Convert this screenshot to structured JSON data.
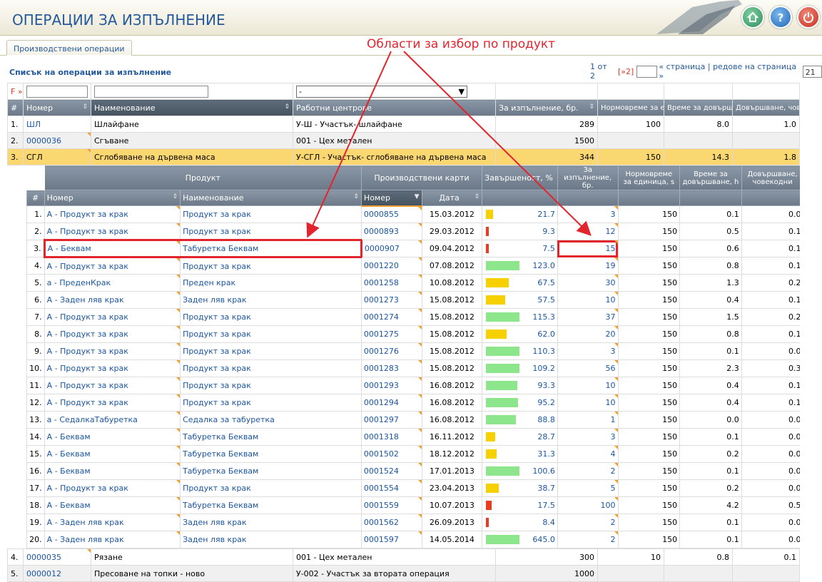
{
  "header": {
    "title": "ОПЕРАЦИИ ЗА ИЗПЪЛНЕНИЕ",
    "icons": [
      "home-icon",
      "help-icon",
      "power-icon"
    ]
  },
  "tabs": [
    {
      "label": "Производствени операции",
      "active": true
    }
  ],
  "annotation": {
    "text": "Области за избор по продукт",
    "color": "#e4242c"
  },
  "list": {
    "title": "Списък на операции за изпълнение",
    "pager": {
      "position": "1 от 2",
      "next": "[»2]",
      "page_label": "« страница | редове на страница »",
      "rows_per_page": "21"
    }
  },
  "filters": {
    "mark": "F »",
    "select_value": "-"
  },
  "main_columns": [
    "#",
    "Номер",
    "Наименование",
    "Работни центрове",
    "За изпълнение, бр.",
    "Нормовреме за единица, s",
    "Време за довършване, h",
    "Довършване, човекодни"
  ],
  "main_rows_top": [
    {
      "idx": "1.",
      "num": "ШЛ",
      "name": "Шлайфане",
      "wc": "У-Ш - Участък- шлайфане",
      "qty": "289",
      "norm": "100",
      "time": "8.0",
      "days": "1.0"
    },
    {
      "idx": "2.",
      "num": "0000036",
      "name": "Сгъване",
      "wc": "001 - Цех метален",
      "qty": "1500",
      "norm": "",
      "time": "",
      "days": ""
    },
    {
      "idx": "3.",
      "num": "СГЛ",
      "name": "Сглобяване на дървена маса",
      "wc": "У-СГЛ - Участък- сглобяване на дървена маса",
      "qty": "344",
      "norm": "150",
      "time": "14.3",
      "days": "1.8"
    }
  ],
  "sub_group_headers": {
    "product": "Продукт",
    "cards": "Производствени карти"
  },
  "sub_columns": [
    "#",
    "Номер",
    "Наименование",
    "Номер",
    "Дата",
    "Завършеност, %",
    "За изпълнение, бр.",
    "Нормовреме за единица, s",
    "Време за довършване, h",
    "Довършване, човекодни"
  ],
  "sub_rows": [
    {
      "idx": "1.",
      "pnum": "А - Продукт за крак",
      "pname": "Продукт за крак",
      "card": "0000855",
      "date": "15.03.2012",
      "pct": "21.7",
      "qty": "3",
      "norm": "150",
      "time": "0.1",
      "days": "0.0"
    },
    {
      "idx": "2.",
      "pnum": "А - Продукт за крак",
      "pname": "Продукт за крак",
      "card": "0000893",
      "date": "29.03.2012",
      "pct": "9.3",
      "qty": "12",
      "norm": "150",
      "time": "0.5",
      "days": "0.1"
    },
    {
      "idx": "3.",
      "pnum": "А - Беквам",
      "pname": "Табуретка Беквам",
      "card": "0000907",
      "date": "09.04.2012",
      "pct": "7.5",
      "qty": "15",
      "norm": "150",
      "time": "0.6",
      "days": "0.1"
    },
    {
      "idx": "4.",
      "pnum": "А - Продукт за крак",
      "pname": "Продукт за крак",
      "card": "0001220",
      "date": "07.08.2012",
      "pct": "123.0",
      "qty": "19",
      "norm": "150",
      "time": "0.8",
      "days": "0.1"
    },
    {
      "idx": "5.",
      "pnum": "а - ПреденКрак",
      "pname": "Преден крак",
      "card": "0001258",
      "date": "10.08.2012",
      "pct": "67.5",
      "qty": "30",
      "norm": "150",
      "time": "1.3",
      "days": "0.2"
    },
    {
      "idx": "6.",
      "pnum": "А - Заден ляв крак",
      "pname": "Заден ляв крак",
      "card": "0001273",
      "date": "15.08.2012",
      "pct": "57.5",
      "qty": "10",
      "norm": "150",
      "time": "0.4",
      "days": "0.1"
    },
    {
      "idx": "7.",
      "pnum": "А - Продукт за крак",
      "pname": "Продукт за крак",
      "card": "0001274",
      "date": "15.08.2012",
      "pct": "115.3",
      "qty": "37",
      "norm": "150",
      "time": "1.5",
      "days": "0.2"
    },
    {
      "idx": "8.",
      "pnum": "А - Продукт за крак",
      "pname": "Продукт за крак",
      "card": "0001275",
      "date": "15.08.2012",
      "pct": "62.0",
      "qty": "20",
      "norm": "150",
      "time": "0.8",
      "days": "0.1"
    },
    {
      "idx": "9.",
      "pnum": "А - Продукт за крак",
      "pname": "Продукт за крак",
      "card": "0001276",
      "date": "15.08.2012",
      "pct": "110.3",
      "qty": "3",
      "norm": "150",
      "time": "0.1",
      "days": "0.0"
    },
    {
      "idx": "10.",
      "pnum": "А - Продукт за крак",
      "pname": "Продукт за крак",
      "card": "0001283",
      "date": "15.08.2012",
      "pct": "109.2",
      "qty": "56",
      "norm": "150",
      "time": "2.3",
      "days": "0.3"
    },
    {
      "idx": "11.",
      "pnum": "А - Продукт за крак",
      "pname": "Продукт за крак",
      "card": "0001293",
      "date": "16.08.2012",
      "pct": "93.3",
      "qty": "10",
      "norm": "150",
      "time": "0.4",
      "days": "0.1"
    },
    {
      "idx": "12.",
      "pnum": "А - Продукт за крак",
      "pname": "Продукт за крак",
      "card": "0001294",
      "date": "16.08.2012",
      "pct": "95.2",
      "qty": "10",
      "norm": "150",
      "time": "0.4",
      "days": "0.1"
    },
    {
      "idx": "13.",
      "pnum": "а - СедалкаТабуретка",
      "pname": "Седалка за табуретка",
      "card": "0001297",
      "date": "16.08.2012",
      "pct": "88.8",
      "qty": "1",
      "norm": "150",
      "time": "0.0",
      "days": "0.0"
    },
    {
      "idx": "14.",
      "pnum": "А - Беквам",
      "pname": "Табуретка Беквам",
      "card": "0001318",
      "date": "16.11.2012",
      "pct": "28.7",
      "qty": "3",
      "norm": "150",
      "time": "0.1",
      "days": "0.0"
    },
    {
      "idx": "15.",
      "pnum": "А - Беквам",
      "pname": "Табуретка Беквам",
      "card": "0001502",
      "date": "18.12.2012",
      "pct": "31.3",
      "qty": "4",
      "norm": "150",
      "time": "0.2",
      "days": "0.0"
    },
    {
      "idx": "16.",
      "pnum": "А - Беквам",
      "pname": "Табуретка Беквам",
      "card": "0001524",
      "date": "17.01.2013",
      "pct": "100.6",
      "qty": "2",
      "norm": "150",
      "time": "0.1",
      "days": "0.0"
    },
    {
      "idx": "17.",
      "pnum": "А - Продукт за крак",
      "pname": "Продукт за крак",
      "card": "0001554",
      "date": "23.04.2013",
      "pct": "38.7",
      "qty": "5",
      "norm": "150",
      "time": "0.2",
      "days": "0.0"
    },
    {
      "idx": "18.",
      "pnum": "А - Беквам",
      "pname": "Табуретка Беквам",
      "card": "0001559",
      "date": "10.07.2013",
      "pct": "17.5",
      "qty": "100",
      "norm": "150",
      "time": "4.2",
      "days": "0.5"
    },
    {
      "idx": "19.",
      "pnum": "А - Заден ляв крак",
      "pname": "Заден ляв крак",
      "card": "0001562",
      "date": "26.09.2013",
      "pct": "8.4",
      "qty": "2",
      "norm": "150",
      "time": "0.1",
      "days": "0.0"
    },
    {
      "idx": "20.",
      "pnum": "А - Заден ляв крак",
      "pname": "Заден ляв крак",
      "card": "0001597",
      "date": "14.05.2014",
      "pct": "645.0",
      "qty": "2",
      "norm": "150",
      "time": "0.1",
      "days": "0.0"
    }
  ],
  "main_rows_bottom": [
    {
      "idx": "4.",
      "num": "0000035",
      "name": "Рязане",
      "wc": "001 - Цех метален",
      "qty": "300",
      "norm": "10",
      "time": "0.8",
      "days": "0.1"
    },
    {
      "idx": "5.",
      "num": "0000012",
      "name": "Пресоване на топки - ново",
      "wc": "У-002 - Участък за втората операция",
      "qty": "1000",
      "norm": "",
      "time": "",
      "days": ""
    }
  ],
  "bar_colors": {
    "low": "#ee3a1e",
    "mid": "#f7d000",
    "high": "#8ee68c"
  }
}
